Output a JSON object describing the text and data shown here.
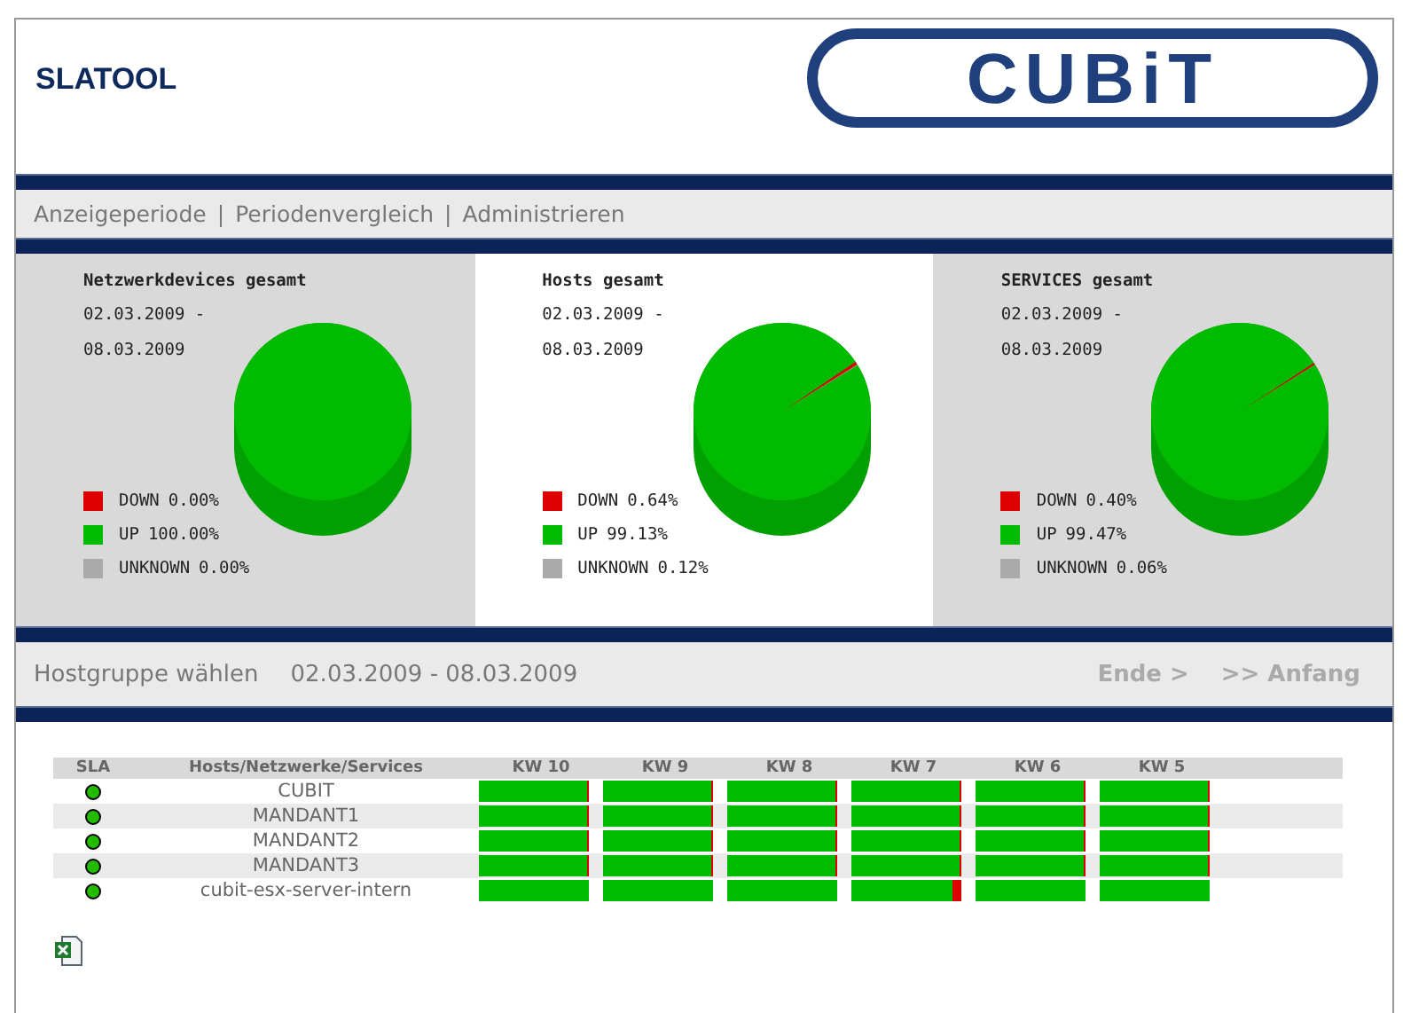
{
  "header": {
    "title": "SLATOOL",
    "logo": "CUBiT"
  },
  "nav": {
    "separator": "|",
    "links": [
      "Anzeigeperiode",
      "Periodenvergleich",
      "Administrieren"
    ]
  },
  "panels": [
    {
      "title": "Netzwerkdevices gesamt",
      "date_from": "02.03.2009 -",
      "date_to": "08.03.2009",
      "highlighted": false,
      "chart_data": {
        "type": "pie",
        "categories": [
          "DOWN",
          "UP",
          "UNKNOWN"
        ],
        "values": [
          0.0,
          100.0,
          0.0
        ],
        "value_labels": [
          "0.00%",
          "100.00%",
          "0.00%"
        ]
      }
    },
    {
      "title": "Hosts gesamt",
      "date_from": "02.03.2009 -",
      "date_to": "08.03.2009",
      "highlighted": true,
      "chart_data": {
        "type": "pie",
        "categories": [
          "DOWN",
          "UP",
          "UNKNOWN"
        ],
        "values": [
          0.64,
          99.13,
          0.12
        ],
        "value_labels": [
          "0.64%",
          "99.13%",
          "0.12%"
        ]
      }
    },
    {
      "title": "SERVICES gesamt",
      "date_from": "02.03.2009 -",
      "date_to": "08.03.2009",
      "highlighted": false,
      "chart_data": {
        "type": "pie",
        "categories": [
          "DOWN",
          "UP",
          "UNKNOWN"
        ],
        "values": [
          0.4,
          99.47,
          0.06
        ],
        "value_labels": [
          "0.40%",
          "99.47%",
          "0.06%"
        ]
      }
    }
  ],
  "period_bar": {
    "label": "Hostgruppe wählen",
    "period": "02.03.2009 - 08.03.2009",
    "links": [
      "Ende >",
      ">> Anfang"
    ]
  },
  "table": {
    "columns": [
      "SLA",
      "Hosts/Netzwerke/Services",
      "KW 10",
      "KW 9",
      "KW 8",
      "KW 7",
      "KW 6",
      "KW 5"
    ],
    "rows": [
      {
        "name": "CUBIT",
        "weeks": [
          {
            "level": 0.98
          },
          {
            "level": 0.98
          },
          {
            "level": 0.98
          },
          {
            "level": 0.98
          },
          {
            "level": 0.98
          },
          {
            "level": 0.98
          }
        ]
      },
      {
        "name": "MANDANT1",
        "weeks": [
          {
            "level": 0.98
          },
          {
            "level": 0.98
          },
          {
            "level": 0.98
          },
          {
            "level": 0.98
          },
          {
            "level": 0.98
          },
          {
            "level": 0.98
          }
        ]
      },
      {
        "name": "MANDANT2",
        "weeks": [
          {
            "level": 0.98
          },
          {
            "level": 0.98
          },
          {
            "level": 0.98
          },
          {
            "level": 0.98
          },
          {
            "level": 0.98
          },
          {
            "level": 0.98
          }
        ]
      },
      {
        "name": "MANDANT3",
        "weeks": [
          {
            "level": 0.98
          },
          {
            "level": 0.98
          },
          {
            "level": 0.98
          },
          {
            "level": 0.98
          },
          {
            "level": 0.98
          },
          {
            "level": 0.98
          }
        ]
      },
      {
        "name": "cubit-esx-server-intern",
        "weeks": [
          {
            "level": 1
          },
          {
            "level": 1
          },
          {
            "level": 1
          },
          {
            "level": 0.92
          },
          {
            "level": 1
          },
          {
            "level": 1
          }
        ]
      }
    ]
  }
}
